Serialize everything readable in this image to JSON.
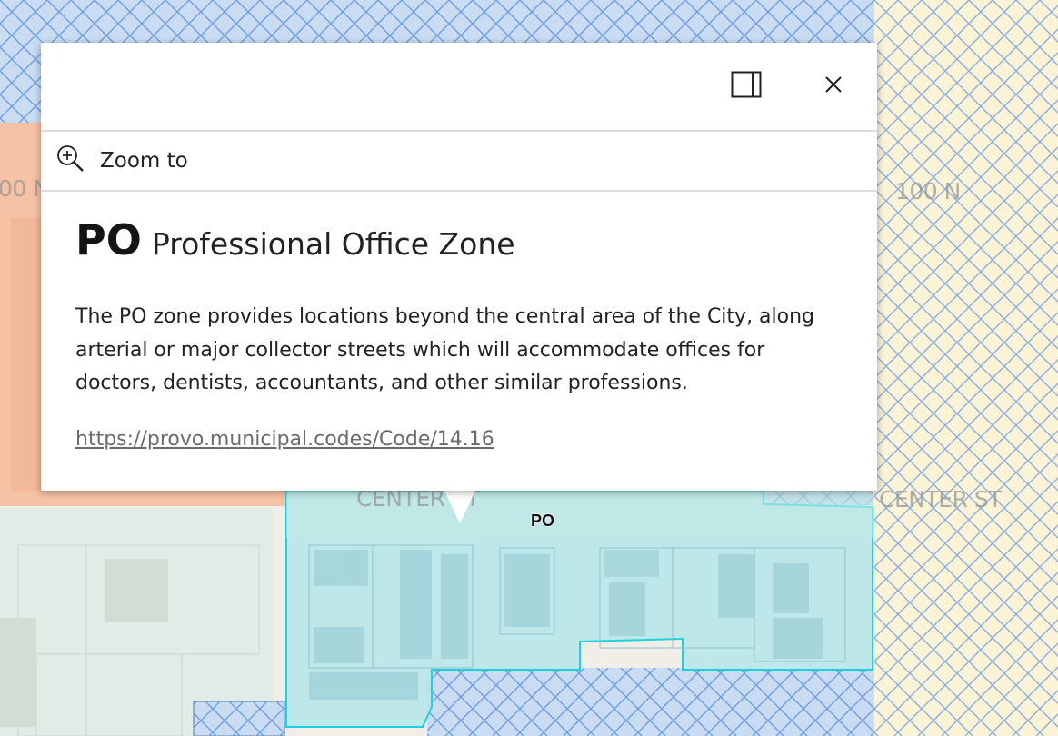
{
  "map": {
    "street_labels": {
      "left_100n": "00 N",
      "right_100n": "100 N",
      "center_left": "CENTER ST",
      "center_right": "CENTER ST"
    },
    "zone_label": "PO",
    "colors": {
      "hatch_fill": "#c9dcf2",
      "hatch_line": "#6f9de6",
      "orange_zone": "#f5c2a6",
      "yellow_zone": "#faf3d6",
      "po_zone": "#b8e6ea",
      "po_outline": "#1fd1dd",
      "grey_zone": "#e2ece6"
    }
  },
  "popup": {
    "dock_icon": "dock-panel-icon",
    "close_icon": "close-icon",
    "zoom_icon": "zoom-in-icon",
    "zoom_label": "Zoom to",
    "title_code": "PO",
    "title_name": "Professional Office Zone",
    "description": "The PO zone provides locations beyond the central area of the City, along arterial or major collector streets which will accommodate offices for doctors, dentists, accountants, and other similar professions.",
    "link": "https://provo.municipal.codes/Code/14.16"
  }
}
